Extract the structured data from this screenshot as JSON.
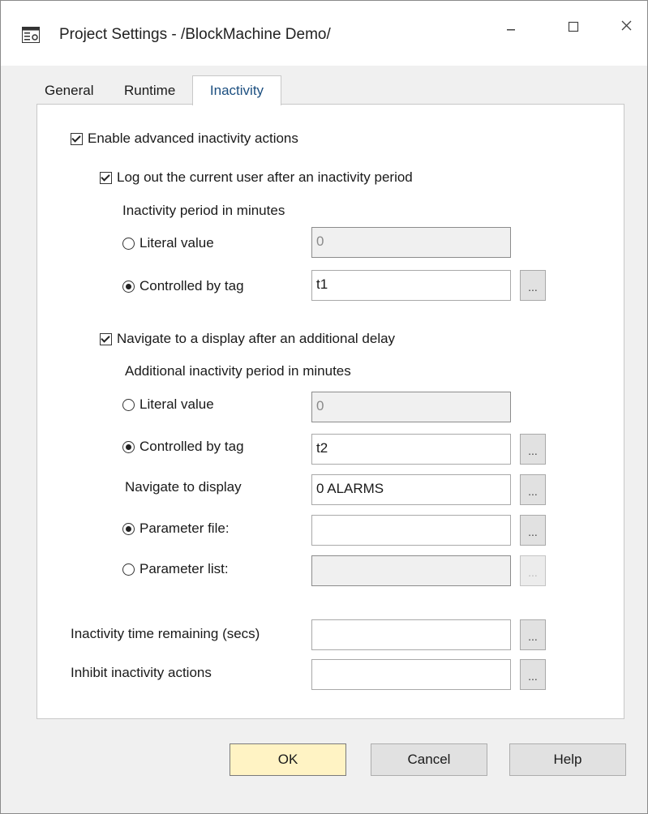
{
  "window": {
    "title": "Project Settings - /BlockMachine Demo/",
    "minimize": "–",
    "maximize": "☐",
    "close": "✕"
  },
  "tabs": [
    "General",
    "Runtime",
    "Inactivity"
  ],
  "inactivity": {
    "enable_advanced": "Enable advanced inactivity actions",
    "logout": {
      "label": "Log out the current user after an inactivity period",
      "period_label": "Inactivity period in minutes",
      "literal_label": "Literal value",
      "literal_value": "0",
      "controlled_label": "Controlled by tag",
      "controlled_value": "t1",
      "browse": "..."
    },
    "navigate": {
      "label": "Navigate to a display after an additional delay",
      "period_label": "Additional inactivity period in minutes",
      "literal_label": "Literal value",
      "literal_value": "0",
      "controlled_label": "Controlled by tag",
      "controlled_value": "t2",
      "display_label": "Navigate to display",
      "display_value": "0 ALARMS",
      "param_file_label": "Parameter file:",
      "param_file_value": "",
      "param_list_label": "Parameter list:",
      "param_list_value": "",
      "browse": "..."
    },
    "time_remaining_label": "Inactivity time remaining (secs)",
    "time_remaining_value": "",
    "inhibit_label": "Inhibit inactivity actions",
    "inhibit_value": ""
  },
  "buttons": {
    "ok": "OK",
    "cancel": "Cancel",
    "help": "Help"
  }
}
